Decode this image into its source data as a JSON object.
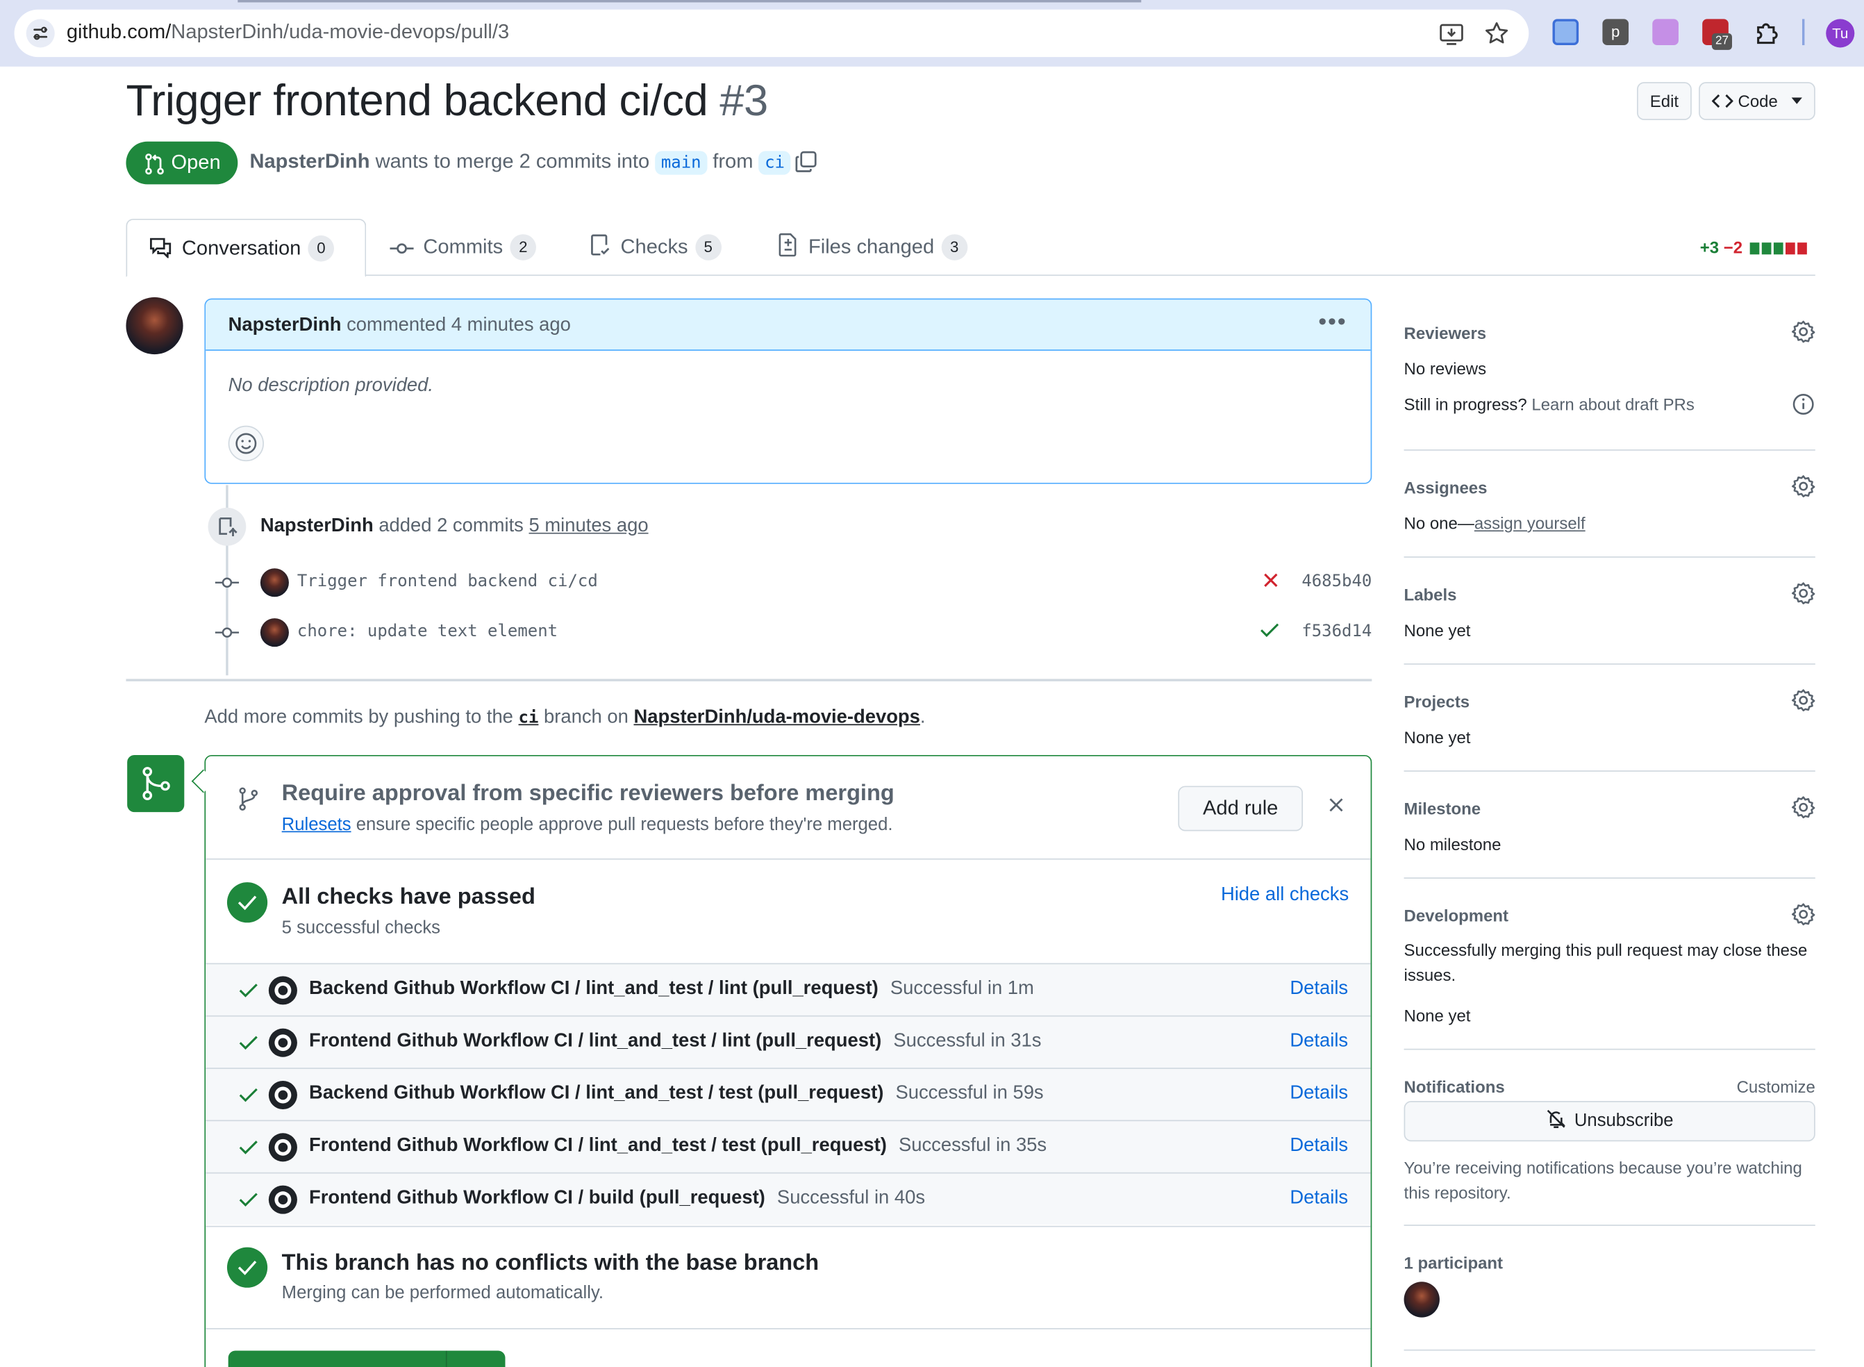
{
  "browser": {
    "url_host": "github.com/",
    "url_path": "NapsterDinh/uda-movie-devops/pull/3",
    "extension_badge": "27",
    "profile_initials": "Tu"
  },
  "header": {
    "title": "Trigger frontend backend ci/cd",
    "number": "#3",
    "edit_label": "Edit",
    "code_label": "Code",
    "state": "Open",
    "author": "NapsterDinh",
    "merge_text_1": "wants to merge 2 commits into",
    "base_branch": "main",
    "merge_text_2": "from",
    "head_branch": "ci"
  },
  "tabs": [
    {
      "label": "Conversation",
      "count": "0"
    },
    {
      "label": "Commits",
      "count": "2"
    },
    {
      "label": "Checks",
      "count": "5"
    },
    {
      "label": "Files changed",
      "count": "3"
    }
  ],
  "diffstat": {
    "additions": "+3",
    "deletions": "−2"
  },
  "comment": {
    "author": "NapsterDinh",
    "action": "commented 4 minutes ago",
    "body": "No description provided."
  },
  "push_event": {
    "author": "NapsterDinh",
    "action": "added 2 commits",
    "time": "5 minutes ago"
  },
  "commits": [
    {
      "message": "Trigger frontend backend ci/cd",
      "sha": "4685b40",
      "status": "fail"
    },
    {
      "message": "chore: update text element",
      "sha": "f536d14",
      "status": "success"
    }
  ],
  "hint": {
    "text_1": "Add more commits by pushing to the",
    "branch": "ci",
    "text_2": "branch on",
    "repo": "NapsterDinh/uda-movie-devops",
    "text_3": "."
  },
  "merge_box": {
    "rule_title": "Require approval from specific reviewers before merging",
    "rule_link": "Rulesets",
    "rule_sub": "ensure specific people approve pull requests before they're merged.",
    "add_rule_label": "Add rule",
    "checks_title": "All checks have passed",
    "checks_sub": "5 successful checks",
    "hide_checks_label": "Hide all checks",
    "checks": [
      {
        "name": "Backend Github Workflow CI / lint_and_test / lint (pull_request)",
        "status": "Successful in 1m",
        "details": "Details"
      },
      {
        "name": "Frontend Github Workflow CI / lint_and_test / lint (pull_request)",
        "status": "Successful in 31s",
        "details": "Details"
      },
      {
        "name": "Backend Github Workflow CI / lint_and_test / test (pull_request)",
        "status": "Successful in 59s",
        "details": "Details"
      },
      {
        "name": "Frontend Github Workflow CI / lint_and_test / test (pull_request)",
        "status": "Successful in 35s",
        "details": "Details"
      },
      {
        "name": "Frontend Github Workflow CI / build (pull_request)",
        "status": "Successful in 40s",
        "details": "Details"
      }
    ],
    "conflict_title": "This branch has no conflicts with the base branch",
    "conflict_sub": "Merging can be performed automatically."
  },
  "sidebar": {
    "reviewers": {
      "title": "Reviewers",
      "value": "No reviews",
      "draft_q": "Still in progress?",
      "draft_link": "Learn about draft PRs"
    },
    "assignees": {
      "title": "Assignees",
      "value": "No one—",
      "link": "assign yourself"
    },
    "labels": {
      "title": "Labels",
      "value": "None yet"
    },
    "projects": {
      "title": "Projects",
      "value": "None yet"
    },
    "milestone": {
      "title": "Milestone",
      "value": "No milestone"
    },
    "development": {
      "title": "Development",
      "text": "Successfully merging this pull request may close these issues.",
      "value": "None yet"
    },
    "notifications": {
      "title": "Notifications",
      "customize": "Customize",
      "unsubscribe": "Unsubscribe",
      "note": "You’re receiving notifications because you’re watching this repository."
    },
    "participants": {
      "title": "1 participant"
    }
  },
  "colors": {
    "accent": "#0969da",
    "success": "#1f883d",
    "danger": "#d1242f",
    "border": "#d1d9e0"
  }
}
